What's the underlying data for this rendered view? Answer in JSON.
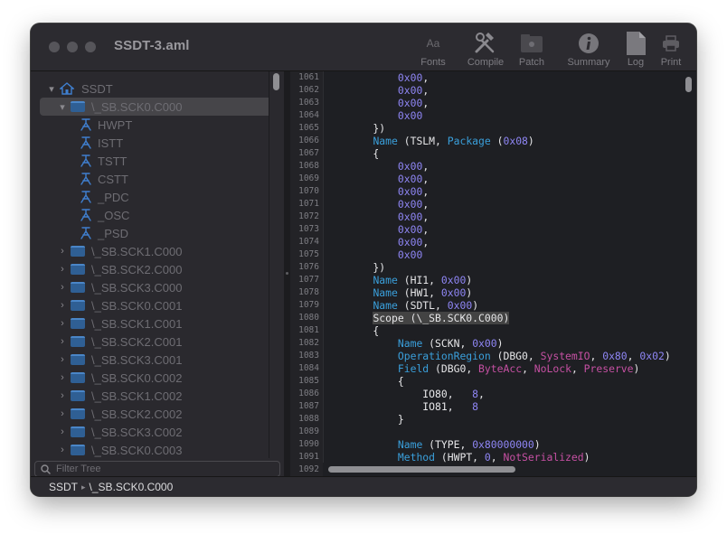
{
  "window": {
    "title": "SSDT-3.aml"
  },
  "toolbar": [
    {
      "label": "Fonts",
      "icon": "fonts-icon"
    },
    {
      "label": "Compile",
      "icon": "compile-icon"
    },
    {
      "label": "Patch",
      "icon": "patch-icon"
    },
    {
      "label": "Summary",
      "icon": "summary-icon"
    },
    {
      "label": "Log",
      "icon": "log-icon"
    },
    {
      "label": "Print",
      "icon": "print-icon"
    }
  ],
  "fonts_glyph": "Aa",
  "tree": {
    "root": "SSDT",
    "selected": "\\_SB.SCK0.C000",
    "children": [
      "HWPT",
      "ISTT",
      "TSTT",
      "CSTT",
      "_PDC",
      "_OSC",
      "_PSD"
    ],
    "collapsed": [
      "\\_SB.SCK1.C000",
      "\\_SB.SCK2.C000",
      "\\_SB.SCK3.C000",
      "\\_SB.SCK0.C001",
      "\\_SB.SCK1.C001",
      "\\_SB.SCK2.C001",
      "\\_SB.SCK3.C001",
      "\\_SB.SCK0.C002",
      "\\_SB.SCK1.C002",
      "\\_SB.SCK2.C002",
      "\\_SB.SCK3.C002",
      "\\_SB.SCK0.C003"
    ]
  },
  "filter": {
    "placeholder": "Filter Tree"
  },
  "line_numbers": [
    "1061",
    "1062",
    "1063",
    "1064",
    "1065",
    "1066",
    "1067",
    "1068",
    "1069",
    "1070",
    "1071",
    "1072",
    "1073",
    "1074",
    "1075",
    "1076",
    "1077",
    "1078",
    "1079",
    "1080",
    "1081",
    "1082",
    "1083",
    "1084",
    "1085",
    "1086",
    "1087",
    "1088",
    "1089",
    "1090",
    "1091",
    "1092"
  ],
  "code_lines": [
    [
      [
        "        ",
        ""
      ],
      [
        "0x00",
        "num"
      ],
      [
        ",",
        ""
      ]
    ],
    [
      [
        "        ",
        ""
      ],
      [
        "0x00",
        "num"
      ],
      [
        ",",
        ""
      ]
    ],
    [
      [
        "        ",
        ""
      ],
      [
        "0x00",
        "num"
      ],
      [
        ",",
        ""
      ]
    ],
    [
      [
        "        ",
        ""
      ],
      [
        "0x00",
        "num"
      ]
    ],
    [
      [
        "    })",
        ""
      ]
    ],
    [
      [
        "    ",
        ""
      ],
      [
        "Name",
        "kw"
      ],
      [
        " (TSLM, ",
        ""
      ],
      [
        "Package",
        "kw"
      ],
      [
        " (",
        ""
      ],
      [
        "0x08",
        "num"
      ],
      [
        ")",
        ""
      ]
    ],
    [
      [
        "    {",
        ""
      ]
    ],
    [
      [
        "        ",
        ""
      ],
      [
        "0x00",
        "num"
      ],
      [
        ",",
        ""
      ]
    ],
    [
      [
        "        ",
        ""
      ],
      [
        "0x00",
        "num"
      ],
      [
        ",",
        ""
      ]
    ],
    [
      [
        "        ",
        ""
      ],
      [
        "0x00",
        "num"
      ],
      [
        ",",
        ""
      ]
    ],
    [
      [
        "        ",
        ""
      ],
      [
        "0x00",
        "num"
      ],
      [
        ",",
        ""
      ]
    ],
    [
      [
        "        ",
        ""
      ],
      [
        "0x00",
        "num"
      ],
      [
        ",",
        ""
      ]
    ],
    [
      [
        "        ",
        ""
      ],
      [
        "0x00",
        "num"
      ],
      [
        ",",
        ""
      ]
    ],
    [
      [
        "        ",
        ""
      ],
      [
        "0x00",
        "num"
      ],
      [
        ",",
        ""
      ]
    ],
    [
      [
        "        ",
        ""
      ],
      [
        "0x00",
        "num"
      ]
    ],
    [
      [
        "    })",
        ""
      ]
    ],
    [
      [
        "    ",
        ""
      ],
      [
        "Name",
        "kw"
      ],
      [
        " (HI1, ",
        ""
      ],
      [
        "0x00",
        "num"
      ],
      [
        ")",
        ""
      ]
    ],
    [
      [
        "    ",
        ""
      ],
      [
        "Name",
        "kw"
      ],
      [
        " (HW1, ",
        ""
      ],
      [
        "0x00",
        "num"
      ],
      [
        ")",
        ""
      ]
    ],
    [
      [
        "    ",
        ""
      ],
      [
        "Name",
        "kw"
      ],
      [
        " (SDTL, ",
        ""
      ],
      [
        "0x00",
        "num"
      ],
      [
        ")",
        ""
      ]
    ],
    [
      [
        "    ",
        ""
      ],
      [
        "Scope (\\_SB.SCK0.C000)",
        "hl"
      ]
    ],
    [
      [
        "    {",
        ""
      ]
    ],
    [
      [
        "        ",
        ""
      ],
      [
        "Name",
        "kw"
      ],
      [
        " (SCKN, ",
        ""
      ],
      [
        "0x00",
        "num"
      ],
      [
        ")",
        ""
      ]
    ],
    [
      [
        "        ",
        ""
      ],
      [
        "OperationRegion",
        "kw"
      ],
      [
        " (DBG0, ",
        ""
      ],
      [
        "SystemIO",
        "pur"
      ],
      [
        ", ",
        ""
      ],
      [
        "0x80",
        "num"
      ],
      [
        ", ",
        ""
      ],
      [
        "0x02",
        "num"
      ],
      [
        ")",
        ""
      ]
    ],
    [
      [
        "        ",
        ""
      ],
      [
        "Field",
        "kw"
      ],
      [
        " (DBG0, ",
        ""
      ],
      [
        "ByteAcc",
        "pur"
      ],
      [
        ", ",
        ""
      ],
      [
        "NoLock",
        "pur"
      ],
      [
        ", ",
        ""
      ],
      [
        "Preserve",
        "pur"
      ],
      [
        ")",
        ""
      ]
    ],
    [
      [
        "        {",
        ""
      ]
    ],
    [
      [
        "            IO80,   ",
        ""
      ],
      [
        "8",
        "num"
      ],
      [
        ",",
        ""
      ]
    ],
    [
      [
        "            IO81,   ",
        ""
      ],
      [
        "8",
        "num"
      ]
    ],
    [
      [
        "        }",
        ""
      ]
    ],
    [
      [
        "",
        ""
      ]
    ],
    [
      [
        "        ",
        ""
      ],
      [
        "Name",
        "kw"
      ],
      [
        " (TYPE, ",
        ""
      ],
      [
        "0x80000000",
        "num"
      ],
      [
        ")",
        ""
      ]
    ],
    [
      [
        "        ",
        ""
      ],
      [
        "Method",
        "kw"
      ],
      [
        " (HWPT, ",
        ""
      ],
      [
        "0",
        "num"
      ],
      [
        ", ",
        ""
      ],
      [
        "NotSerialized",
        "pur"
      ],
      [
        ")",
        ""
      ]
    ],
    [
      [
        "",
        ""
      ]
    ]
  ],
  "status": {
    "root": "SSDT",
    "path": "\\_SB.SCK0.C000"
  }
}
